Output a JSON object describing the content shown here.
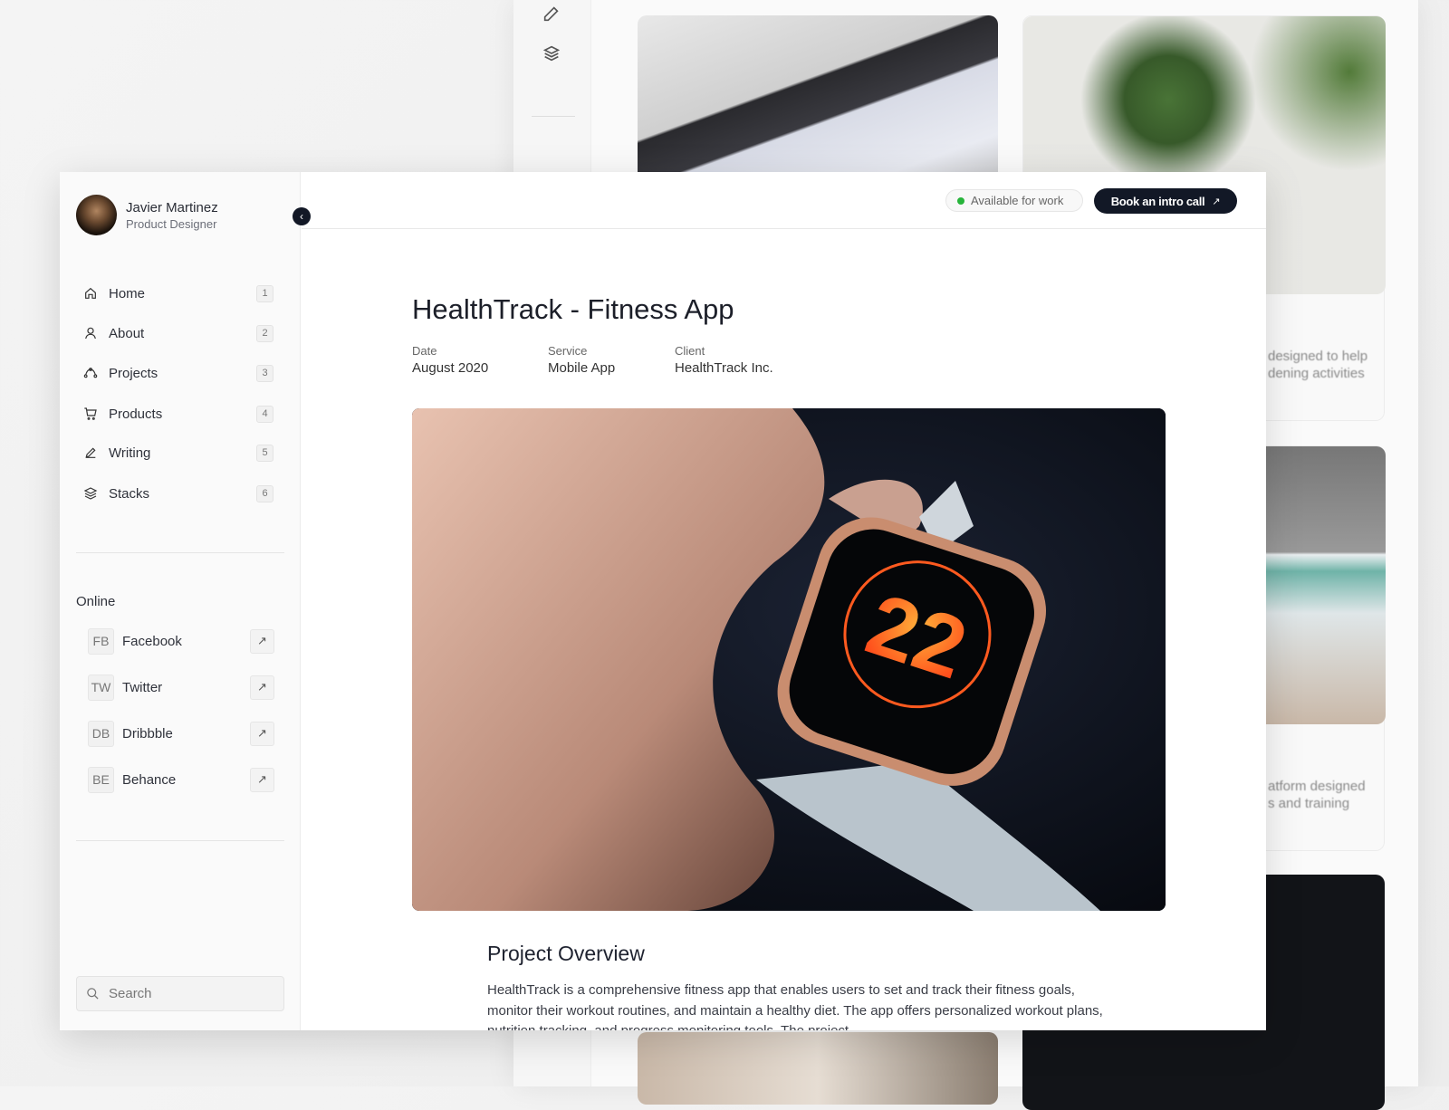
{
  "background_window": {
    "card_text_1": [
      "designed to help",
      "dening activities"
    ],
    "card_text_2": [
      "atform designed",
      "s and training"
    ]
  },
  "profile": {
    "name": "Javier Martinez",
    "role": "Product Designer"
  },
  "nav": [
    {
      "label": "Home",
      "key": "1",
      "icon": "home-icon"
    },
    {
      "label": "About",
      "key": "2",
      "icon": "user-icon"
    },
    {
      "label": "Projects",
      "key": "3",
      "icon": "bezier-icon"
    },
    {
      "label": "Products",
      "key": "4",
      "icon": "cart-icon"
    },
    {
      "label": "Writing",
      "key": "5",
      "icon": "pen-icon"
    },
    {
      "label": "Stacks",
      "key": "6",
      "icon": "layers-icon"
    }
  ],
  "online": {
    "heading": "Online",
    "items": [
      {
        "abbr": "FB",
        "label": "Facebook"
      },
      {
        "abbr": "TW",
        "label": "Twitter"
      },
      {
        "abbr": "DB",
        "label": "Dribbble"
      },
      {
        "abbr": "BE",
        "label": "Behance"
      }
    ]
  },
  "search": {
    "placeholder": "Search"
  },
  "header": {
    "status": "Available for work",
    "status_color": "#27b43b",
    "cta": "Book an intro call",
    "cta_icon": "↗"
  },
  "project": {
    "title": "HealthTrack - Fitness App",
    "meta": [
      {
        "label": "Date",
        "value": "August 2020"
      },
      {
        "label": "Service",
        "value": "Mobile App"
      },
      {
        "label": "Client",
        "value": "HealthTrack Inc."
      }
    ],
    "watch_digits": "22",
    "overview_heading": "Project Overview",
    "overview_text": "HealthTrack is a comprehensive fitness app that enables users to set and track their fitness goals, monitor their workout routines, and maintain a healthy diet. The app offers personalized workout plans, nutrition tracking, and progress monitoring tools. The project"
  }
}
